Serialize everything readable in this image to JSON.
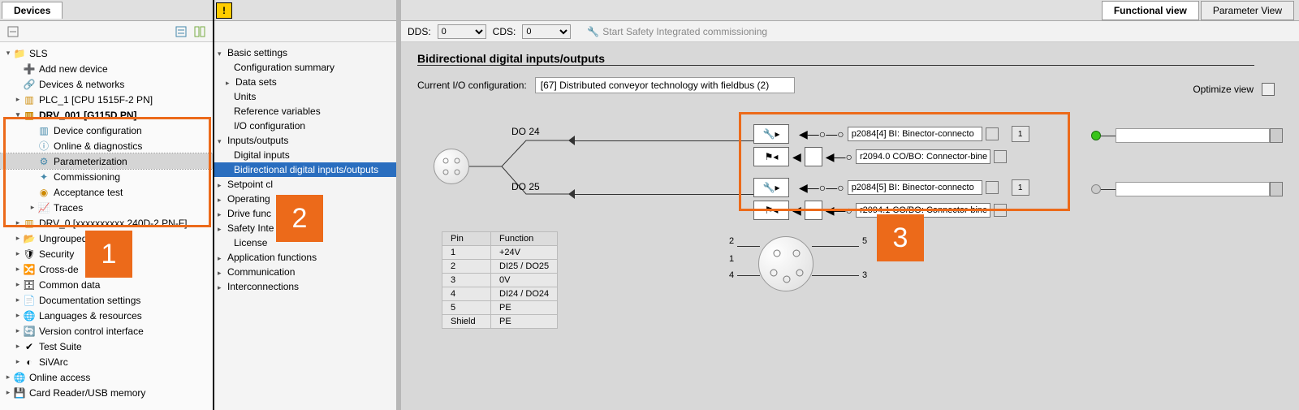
{
  "left": {
    "tab": "Devices",
    "tree": {
      "sls": "SLS",
      "add_device": "Add new device",
      "devices_networks": "Devices & networks",
      "plc1": "PLC_1 [CPU 1515F-2 PN]",
      "drv001": "DRV_001 [G115D PN]",
      "device_config": "Device configuration",
      "online_diag": "Online & diagnostics",
      "parameterization": "Parameterization",
      "commissioning": "Commissioning",
      "acceptance_test": "Acceptance test",
      "traces": "Traces",
      "drv0": "DRV_0 [xxxxxxxxxx 240D-2 PN-F]",
      "ungrouped": "Ungrouped",
      "security": "Security",
      "cross": "Cross-de",
      "common_data": "Common data",
      "doc_settings": "Documentation settings",
      "lang_res": "Languages & resources",
      "vcs": "Version control interface",
      "test_suite": "Test Suite",
      "sivarc": "SiVArc",
      "online_access": "Online access",
      "card_reader": "Card Reader/USB memory"
    }
  },
  "mid": {
    "group_basic": "Basic settings",
    "config_summary": "Configuration summary",
    "data_sets": "Data sets",
    "units": "Units",
    "ref_vars": "Reference variables",
    "io_config": "I/O configuration",
    "group_io": "Inputs/outputs",
    "digital_inputs": "Digital inputs",
    "bidir": "Bidirectional digital inputs/outputs",
    "setpoint": "Setpoint cl",
    "operating": "Operating",
    "drive_fn": "Drive func",
    "safety": "Safety Inte",
    "license": "License",
    "app_fn": "Application functions",
    "comm": "Communication",
    "interconn": "Interconnections"
  },
  "right": {
    "tab_functional": "Functional view",
    "tab_param": "Parameter View",
    "dds_label": "DDS:",
    "cds_label": "CDS:",
    "dds_value": "0",
    "cds_value": "0",
    "safety_start": "Start Safety Integrated commissioning",
    "main_title": "Bidirectional digital inputs/outputs",
    "current_cfg": "Current I/O configuration:",
    "cfg_value": "[67] Distributed conveyor technology with fieldbus (2)",
    "optimize": "Optimize view",
    "do24": "DO 24",
    "do25": "DO 25",
    "param_p2084_4": "p2084[4] BI: Binector-connecto",
    "param_r2094_0": "r2094.0 CO/BO: Connector-bine",
    "param_p2084_5": "p2084[5] BI: Binector-connecto",
    "param_r2094_1": "r2094.1 CO/BO: Connector-bine",
    "idx1": "1",
    "pin_table": {
      "h_pin": "Pin",
      "h_fn": "Function",
      "r1a": "1",
      "r1b": "+24V",
      "r2a": "2",
      "r2b": "DI25 / DO25",
      "r3a": "3",
      "r3b": "0V",
      "r4a": "4",
      "r4b": "DI24 / DO24",
      "r5a": "5",
      "r5b": "PE",
      "r6a": "Shield",
      "r6b": "PE"
    },
    "pins": {
      "p1": "1",
      "p2": "2",
      "p3": "3",
      "p4": "4",
      "p5": "5"
    }
  },
  "callout1": "1",
  "callout2": "2",
  "callout3": "3"
}
